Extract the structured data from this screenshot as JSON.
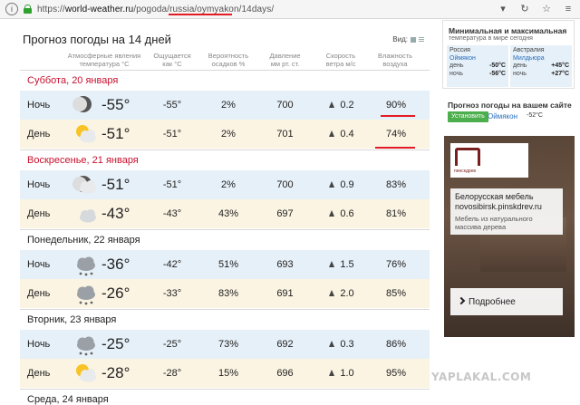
{
  "browser": {
    "url_prefix": "https://",
    "url_host": "world-weather.ru",
    "url_path": "/pogoda/russia/oymyakon/14days/"
  },
  "main": {
    "title": "Прогноз погоды на 14 дней",
    "view_label": "Вид:",
    "columns": {
      "state": "Атмосферные явления\nтемпература °С",
      "feels": "Ощущается\nкак °С",
      "precip": "Вероятность\nосадков %",
      "pressure": "Давление\nмм рт. ст.",
      "wind": "Скорость\nветра м/с",
      "humidity": "Влажность\nвоздуха"
    },
    "days": [
      {
        "heading": "Суббота, 20 января",
        "rows": [
          {
            "label": "Ночь",
            "icon": "moon-icon",
            "temp": "-55°",
            "feels": "-55°",
            "precip": "2%",
            "pressure": "700",
            "wind": "0.2",
            "humidity": "90%"
          },
          {
            "label": "День",
            "icon": "sun-cloud-icon",
            "temp": "-51°",
            "feels": "-51°",
            "precip": "2%",
            "pressure": "701",
            "wind": "0.4",
            "humidity": "74%"
          }
        ]
      },
      {
        "heading": "Воскресенье, 21 января",
        "rows": [
          {
            "label": "Ночь",
            "icon": "moon-cloud-icon",
            "temp": "-51°",
            "feels": "-51°",
            "precip": "2%",
            "pressure": "700",
            "wind": "0.9",
            "humidity": "83%"
          },
          {
            "label": "День",
            "icon": "cloud-icon",
            "temp": "-43°",
            "feels": "-43°",
            "precip": "43%",
            "pressure": "697",
            "wind": "0.6",
            "humidity": "81%"
          }
        ]
      },
      {
        "heading": "Понедельник, 22 января",
        "rows": [
          {
            "label": "Ночь",
            "icon": "snow-cloud-icon",
            "temp": "-36°",
            "feels": "-42°",
            "precip": "51%",
            "pressure": "693",
            "wind": "1.5",
            "humidity": "76%"
          },
          {
            "label": "День",
            "icon": "snow-cloud-icon",
            "temp": "-26°",
            "feels": "-33°",
            "precip": "83%",
            "pressure": "691",
            "wind": "2.0",
            "humidity": "85%"
          }
        ]
      },
      {
        "heading": "Вторник, 23 января",
        "rows": [
          {
            "label": "Ночь",
            "icon": "snow-cloud-icon",
            "temp": "-25°",
            "feels": "-25°",
            "precip": "73%",
            "pressure": "692",
            "wind": "0.3",
            "humidity": "86%"
          },
          {
            "label": "День",
            "icon": "sun-cloud-icon",
            "temp": "-28°",
            "feels": "-28°",
            "precip": "15%",
            "pressure": "696",
            "wind": "1.0",
            "humidity": "95%"
          }
        ]
      },
      {
        "heading": "Среда, 24 января",
        "rows": []
      }
    ]
  },
  "sidebar": {
    "extremes": {
      "title": "Минимальная и максимальная",
      "subtitle": "температура в мире сегодня",
      "min": {
        "country": "Россия",
        "place": "Оймякон",
        "day_label": "день",
        "day_value": "-50°C",
        "night_label": "ночь",
        "night_value": "-56°C"
      },
      "max": {
        "country": "Австралия",
        "place": "Милдьюра",
        "day_label": "день",
        "day_value": "+45°C",
        "night_label": "ночь",
        "night_value": "+27°C"
      }
    },
    "widget": {
      "title": "Прогноз погоды на вашем сайте",
      "button": "Установить",
      "place": "Оймякон",
      "temp": "-52°C"
    },
    "ad": {
      "brand": "пинскдрев",
      "title": "Белорусская мебель novosibirsk.pinskdrev.ru",
      "desc": "Мебель из натурального массива дерева",
      "more": "Подробнее"
    }
  },
  "watermark": "YAPLAKAL.COM",
  "colors": {
    "accent_red": "#c8102e",
    "night_bg": "#e6f0f8",
    "day_bg": "#fbf4e3",
    "link_blue": "#2a6ebb",
    "button_green": "#4cae4c"
  }
}
